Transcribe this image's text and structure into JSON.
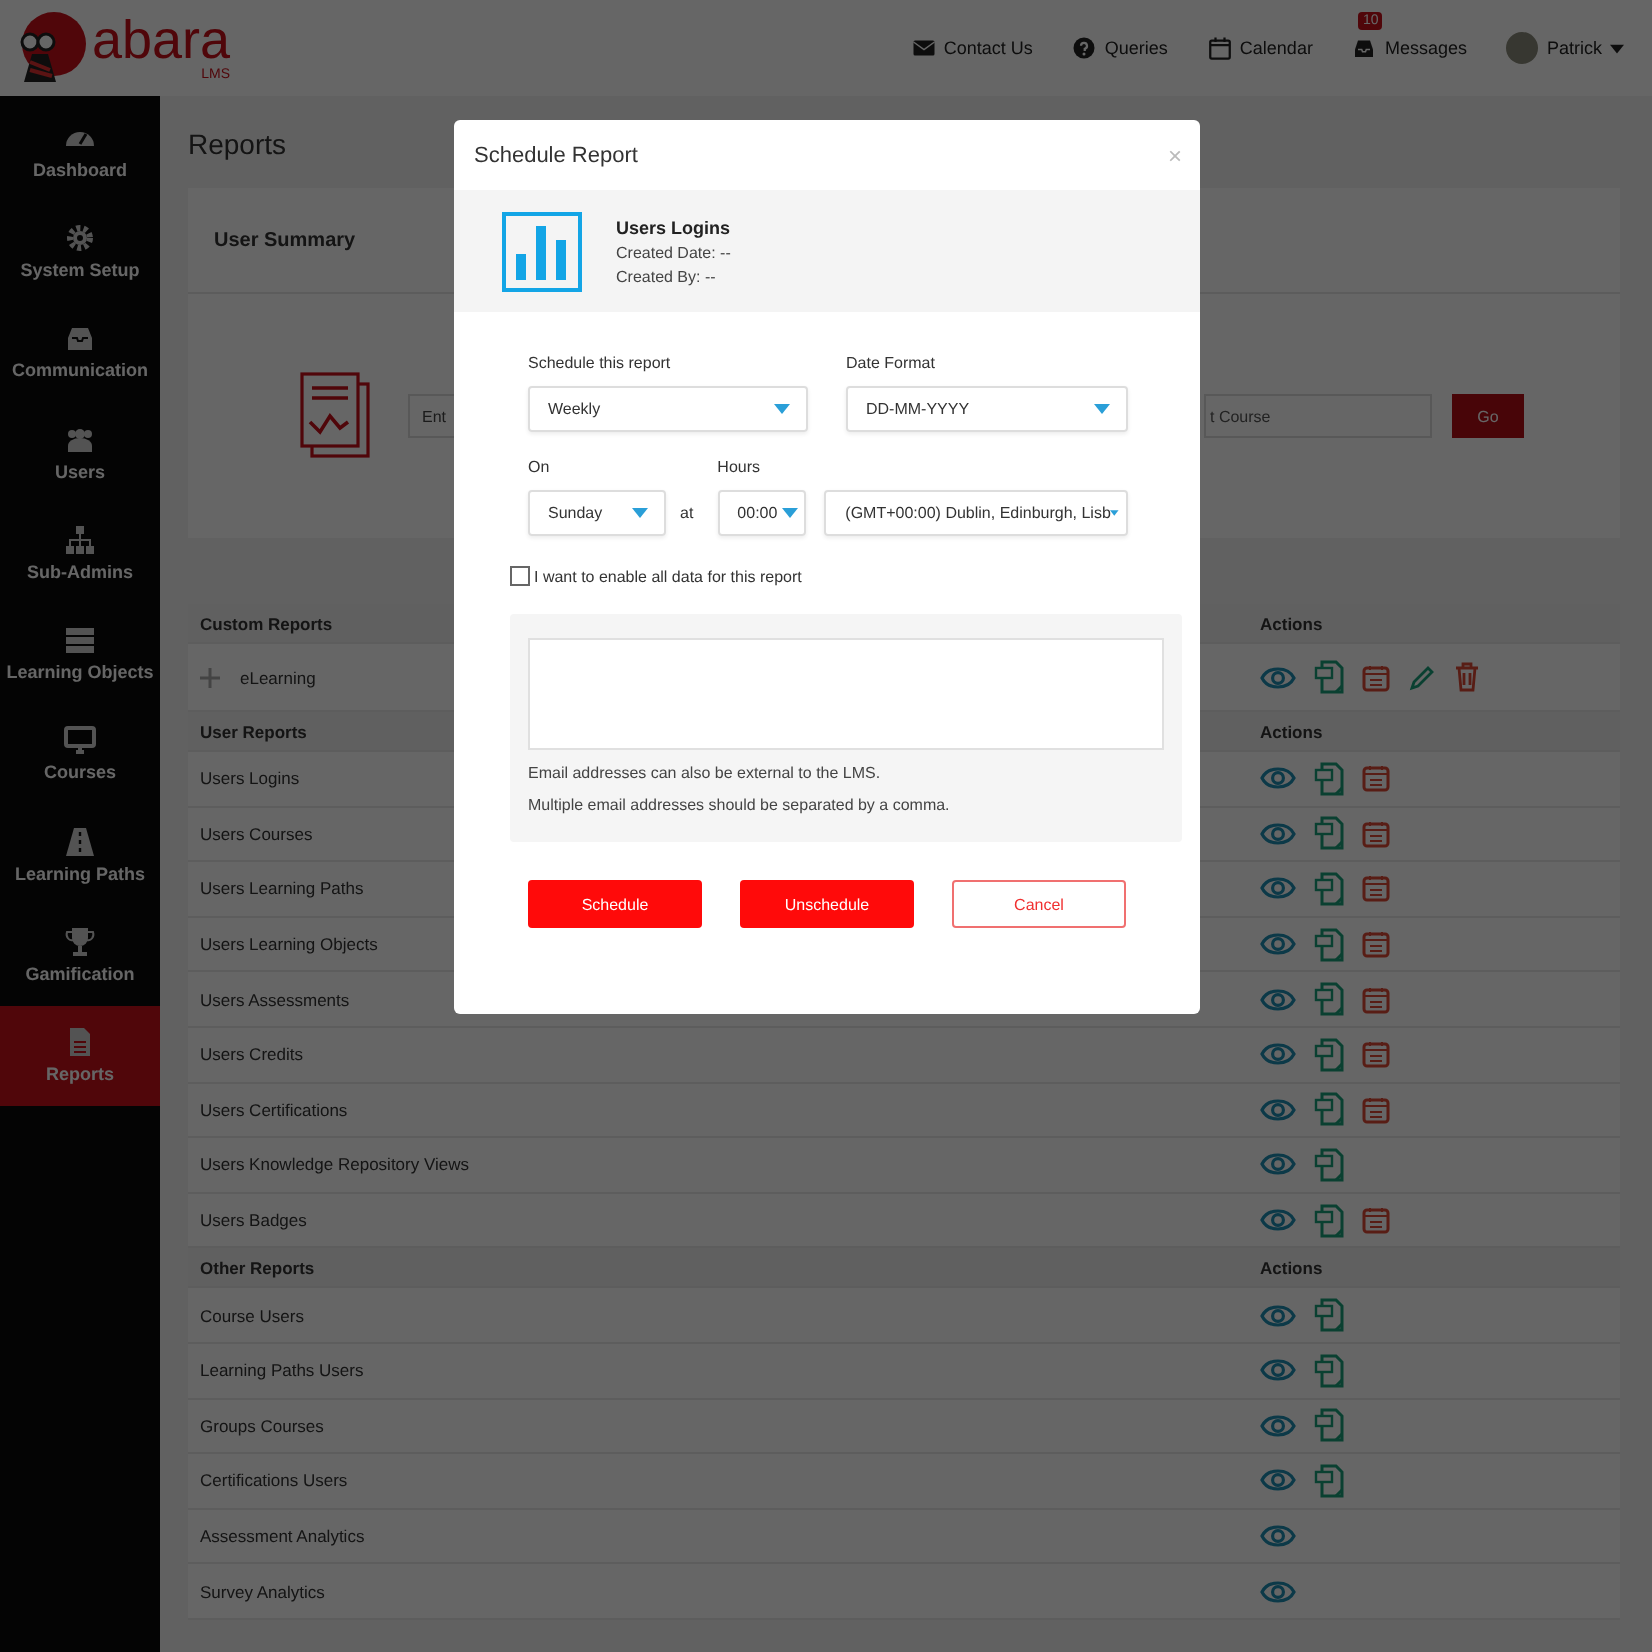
{
  "header": {
    "logo": {
      "word": "abara",
      "sub": "LMS"
    },
    "nav": [
      {
        "kind": "mail",
        "label": "Contact Us"
      },
      {
        "kind": "help",
        "label": "Queries"
      },
      {
        "kind": "calendar",
        "label": "Calendar"
      },
      {
        "kind": "inbox",
        "label": "Messages",
        "badge": "10"
      },
      {
        "kind": "user",
        "label": "Patrick"
      }
    ]
  },
  "sidebar": {
    "items": [
      {
        "label": "Dashboard",
        "selected": false
      },
      {
        "label": "System Setup",
        "selected": false
      },
      {
        "label": "Communication",
        "selected": false
      },
      {
        "label": "Users",
        "selected": false
      },
      {
        "label": "Sub-Admins",
        "selected": false
      },
      {
        "label": "Learning Objects",
        "selected": false
      },
      {
        "label": "Courses",
        "selected": false
      },
      {
        "label": "Learning Paths",
        "selected": false
      },
      {
        "label": "Gamification",
        "selected": false
      },
      {
        "label": "Reports",
        "selected": true
      }
    ]
  },
  "page": {
    "title": "Reports",
    "summary": {
      "title": "User Summary",
      "search_placeholder": "Ent",
      "course_field": "t Course",
      "go": "Go"
    },
    "sections": [
      {
        "title": "Custom Reports",
        "actions_heading": "Actions",
        "rows": [
          {
            "name": "eLearning",
            "draggable": true,
            "actions": [
              {
                "kind": "view"
              },
              {
                "kind": "export"
              },
              {
                "kind": "schedule"
              },
              {
                "kind": "edit"
              },
              {
                "kind": "delete"
              }
            ]
          }
        ]
      },
      {
        "title": "User Reports",
        "actions_heading": "Actions",
        "rows": [
          {
            "name": "Users Logins",
            "draggable": false,
            "actions": [
              {
                "kind": "view"
              },
              {
                "kind": "export"
              },
              {
                "kind": "schedule"
              }
            ]
          },
          {
            "name": "Users Courses",
            "draggable": false,
            "actions": [
              {
                "kind": "view"
              },
              {
                "kind": "export"
              },
              {
                "kind": "schedule"
              }
            ]
          },
          {
            "name": "Users Learning Paths",
            "draggable": false,
            "actions": [
              {
                "kind": "view"
              },
              {
                "kind": "export"
              },
              {
                "kind": "schedule"
              }
            ]
          },
          {
            "name": "Users Learning Objects",
            "draggable": false,
            "actions": [
              {
                "kind": "view"
              },
              {
                "kind": "export"
              },
              {
                "kind": "schedule"
              }
            ]
          },
          {
            "name": "Users Assessments",
            "draggable": false,
            "actions": [
              {
                "kind": "view"
              },
              {
                "kind": "export"
              },
              {
                "kind": "schedule"
              }
            ]
          },
          {
            "name": "Users Credits",
            "draggable": false,
            "actions": [
              {
                "kind": "view"
              },
              {
                "kind": "export"
              },
              {
                "kind": "schedule"
              }
            ]
          },
          {
            "name": "Users Certifications",
            "draggable": false,
            "actions": [
              {
                "kind": "view"
              },
              {
                "kind": "export"
              },
              {
                "kind": "schedule"
              }
            ]
          },
          {
            "name": "Users Knowledge Repository Views",
            "draggable": false,
            "actions": [
              {
                "kind": "view"
              },
              {
                "kind": "export"
              }
            ]
          },
          {
            "name": "Users Badges",
            "draggable": false,
            "actions": [
              {
                "kind": "view"
              },
              {
                "kind": "export"
              },
              {
                "kind": "schedule"
              }
            ]
          }
        ]
      },
      {
        "title": "Other Reports",
        "actions_heading": "Actions",
        "rows": [
          {
            "name": "Course Users",
            "draggable": false,
            "actions": [
              {
                "kind": "view"
              },
              {
                "kind": "export"
              }
            ]
          },
          {
            "name": "Learning Paths Users",
            "draggable": false,
            "actions": [
              {
                "kind": "view"
              },
              {
                "kind": "export"
              }
            ]
          },
          {
            "name": "Groups Courses",
            "draggable": false,
            "actions": [
              {
                "kind": "view"
              },
              {
                "kind": "export"
              }
            ]
          },
          {
            "name": "Certifications Users",
            "draggable": false,
            "actions": [
              {
                "kind": "view"
              },
              {
                "kind": "export"
              }
            ]
          },
          {
            "name": "Assessment Analytics",
            "draggable": false,
            "actions": [
              {
                "kind": "view"
              }
            ]
          },
          {
            "name": "Survey Analytics",
            "draggable": false,
            "actions": [
              {
                "kind": "view"
              }
            ]
          }
        ]
      }
    ]
  },
  "modal": {
    "title": "Schedule Report",
    "close": "×",
    "report": {
      "name": "Users Logins",
      "created_date": "Created Date: --",
      "created_by": "Created By: --"
    },
    "schedule_label": "Schedule this report",
    "schedule_value": "Weekly",
    "date_format_label": "Date Format",
    "date_format_value": "DD-MM-YYYY",
    "on_label": "On",
    "day_value": "Sunday",
    "at": "at",
    "hours_label": "Hours",
    "hour_value": "00:00",
    "timezone_value": "(GMT+00:00) Dublin, Edinburgh, Lisb",
    "all_data": {
      "label": "I want to enable all data for this report",
      "checked": false
    },
    "notes": [
      "Email addresses can also be external to the LMS.",
      "Multiple email addresses should be separated by a comma."
    ],
    "buttons": [
      {
        "kind": "primary",
        "label": "Schedule"
      },
      {
        "kind": "primary",
        "label": "Unschedule"
      },
      {
        "kind": "outline",
        "label": "Cancel"
      }
    ]
  }
}
